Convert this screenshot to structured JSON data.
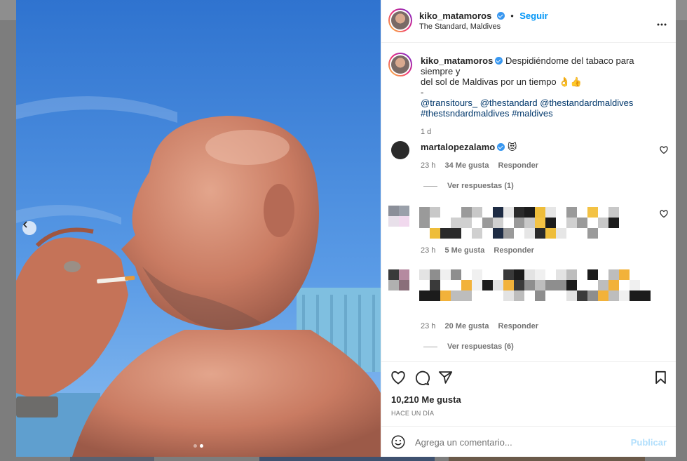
{
  "post": {
    "author": "kiko_matamoros",
    "follow_label": "Seguir",
    "location": "The Standard, Maldives",
    "caption_line1": "Despidiéndome del tabaco para siempre y",
    "caption_line2": "del sol de Maldivas por un tiempo 👌👍",
    "caption_dash": "-",
    "caption_mentions": "@transitours_ @thestandard @thestandardmaldives",
    "caption_tags": "#thestsndardmaldives #maldives",
    "caption_time": "1 d",
    "likes": "10,210 Me gusta",
    "posted": "HACE UN DÍA",
    "image_count": 2,
    "image_index": 2
  },
  "comments": [
    {
      "author": "martalopezalamo",
      "text": "😻",
      "time": "23 h",
      "likes": "34 Me gusta",
      "reply": "Responder",
      "view_replies": "Ver respuestas (1)"
    },
    {
      "author": "",
      "text": "",
      "time": "23 h",
      "likes": "5 Me gusta",
      "reply": "Responder"
    },
    {
      "author": "",
      "text": "",
      "time": "23 h",
      "likes": "20 Me gusta",
      "reply": "Responder",
      "view_replies": "Ver respuestas (6)"
    }
  ],
  "composer": {
    "placeholder": "Agrega un comentario...",
    "publish": "Publicar"
  },
  "colors": {
    "accent": "#0095f6",
    "verified": "#3897f0",
    "muted_text": "#737373",
    "publish_disabled": "#b2dffc"
  },
  "icons": [
    "more-options-icon",
    "heart-icon",
    "comment-icon",
    "share-icon",
    "bookmark-icon",
    "emoji-icon",
    "chevron-left-icon",
    "verified-icon"
  ]
}
